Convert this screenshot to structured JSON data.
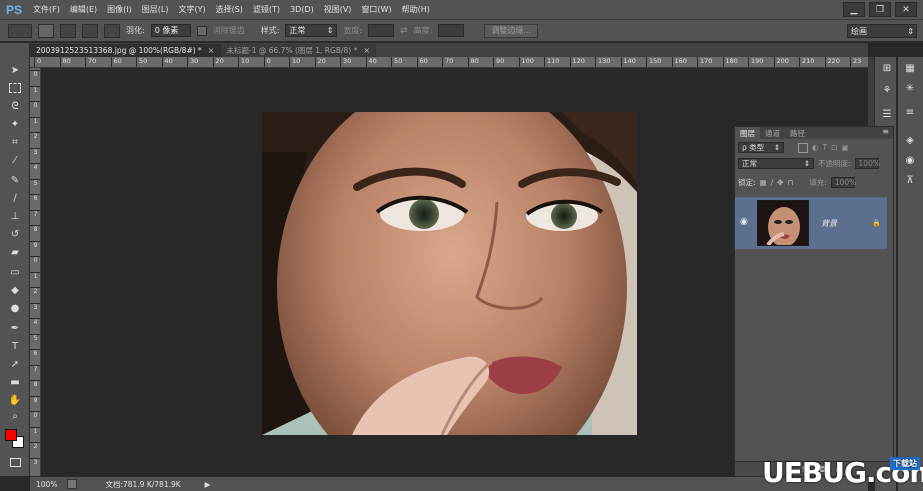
{
  "app": {
    "logo": "PS"
  },
  "menus": [
    "文件(F)",
    "编辑(E)",
    "图像(I)",
    "图层(L)",
    "文字(Y)",
    "选择(S)",
    "滤镜(T)",
    "3D(D)",
    "视图(V)",
    "窗口(W)",
    "帮助(H)"
  ],
  "window_controls": [
    "▁",
    "❐",
    "✕"
  ],
  "options": {
    "feather_label": "羽化:",
    "feather_value": "0 像素",
    "antialias_label": "消除锯齿",
    "style_label": "样式:",
    "style_value": "正常",
    "width_label": "宽度:",
    "height_label": "高度:",
    "refine_edge_button": "调整边缘...",
    "workspace_value": "绘画"
  },
  "tabs": [
    {
      "label": "2003912523513368.jpg @ 100%(RGB/8#) *",
      "close": "×"
    },
    {
      "label": "未标题-1 @ 66.7% (图层 1, RGB/8) *",
      "close": "×"
    }
  ],
  "ruler_h": [
    "0",
    "80",
    "70",
    "60",
    "50",
    "40",
    "30",
    "20",
    "10",
    "0",
    "10",
    "20",
    "30",
    "40",
    "50",
    "60",
    "70",
    "80",
    "90",
    "100",
    "110",
    "120",
    "130",
    "140",
    "150",
    "160",
    "170",
    "180",
    "190",
    "200",
    "210",
    "220",
    "23"
  ],
  "ruler_v": [
    "0",
    "1",
    "0",
    "1",
    "2",
    "3",
    "4",
    "5",
    "6",
    "7",
    "8",
    "9",
    "0",
    "1",
    "2",
    "3",
    "4",
    "5",
    "6",
    "7",
    "8",
    "9",
    "0",
    "1",
    "2",
    "3"
  ],
  "status": {
    "zoom": "100%",
    "doc_size": "文档:781.9 K/781.9K",
    "arrow": "▶"
  },
  "layers_panel": {
    "tabs": [
      "图层",
      "通道",
      "路径"
    ],
    "filter_kind": "ρ 类型",
    "blend_mode": "正常",
    "opacity_label": "不透明度:",
    "opacity_value": "100%",
    "lock_label": "锁定:",
    "fill_label": "填充:",
    "fill_value": "100%",
    "layer_name": "背景",
    "layer_lock": "🔒"
  },
  "watermark": {
    "text": "UEBUG.com",
    "badge": "下载站"
  },
  "colors": {
    "foreground": "#ff0000",
    "background": "#ffffff",
    "selected_layer": "#5d6f8f",
    "logo": "#6fb4e8"
  },
  "icons": {
    "toolbar": [
      "move-icon",
      "marquee-icon",
      "lasso-icon",
      "magic-wand-icon",
      "crop-icon",
      "eyedropper-icon",
      "healing-brush-icon",
      "brush-icon",
      "clone-stamp-icon",
      "history-brush-icon",
      "eraser-icon",
      "gradient-icon",
      "blur-icon",
      "dodge-icon",
      "pen-icon",
      "type-icon",
      "path-selection-icon",
      "shape-icon",
      "hand-icon",
      "zoom-icon"
    ]
  }
}
